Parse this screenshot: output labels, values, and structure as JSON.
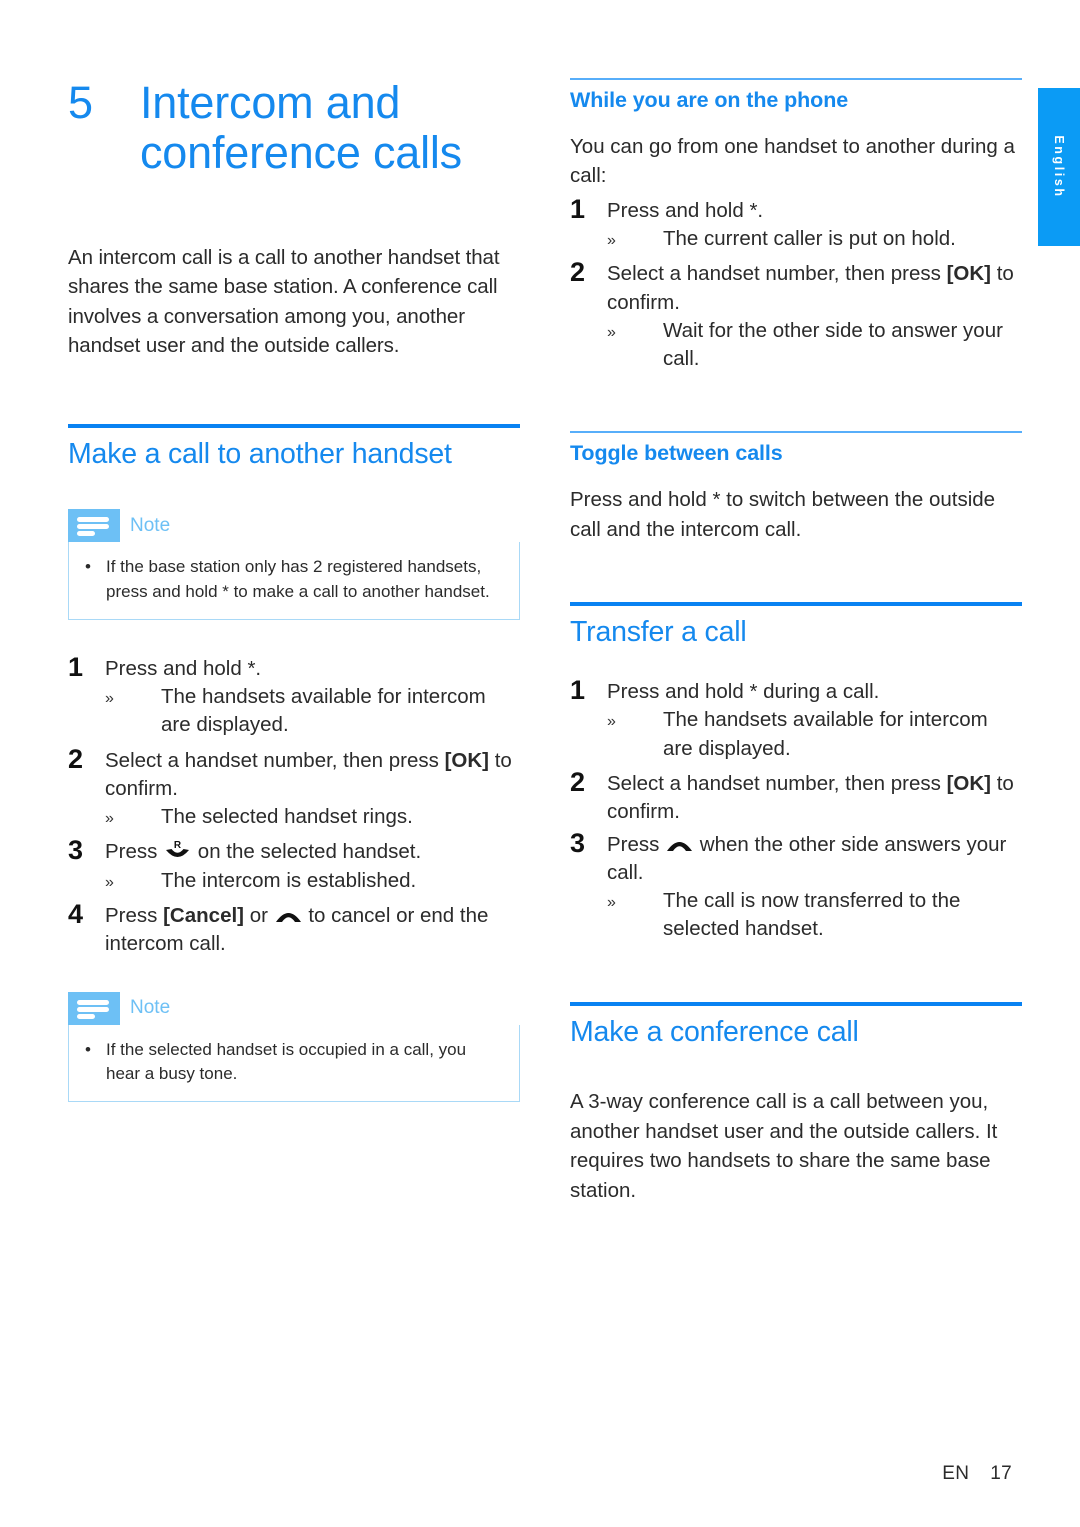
{
  "language_tab": {
    "label": "English"
  },
  "colors": {
    "heading_blue": "#1589EE",
    "rule_blue": "#0982F2",
    "subrule_blue": "#57AEFA",
    "note_blue": "#6DC0F5",
    "tab_blue": "#0B9BF5",
    "body_text": "#2B2B2B"
  },
  "chapter": {
    "number": "5",
    "title": "Intercom and conference calls",
    "intro": "An intercom call is a call to another handset that shares the same base station. A conference call involves a conversation among you, another handset user and the outside callers."
  },
  "left_column": {
    "section": {
      "title": "Make a call to another handset"
    },
    "note_1": {
      "label": "Note",
      "items": [
        "If the base station only has 2 registered handsets, press and hold * to make a call to another handset."
      ]
    },
    "steps": [
      {
        "num": "1",
        "text": "Press and hold *.",
        "results": [
          "The handsets available for intercom are displayed."
        ]
      },
      {
        "num": "2",
        "text_before": "Select a handset number, then press ",
        "key": "[OK]",
        "text_after": " to confirm.",
        "results": [
          "The selected handset rings."
        ]
      },
      {
        "num": "3",
        "text_before": "Press ",
        "icon": "recall-key-icon",
        "text_after": " on the selected handset.",
        "results": [
          "The intercom is established."
        ]
      },
      {
        "num": "4",
        "text_before": "Press ",
        "key": "[Cancel]",
        "text_middle": " or ",
        "icon": "hangup-icon",
        "text_after": " to cancel or end the intercom call.",
        "results": []
      }
    ],
    "note_2": {
      "label": "Note",
      "items": [
        "If the selected handset is occupied in a call, you hear a busy tone."
      ]
    }
  },
  "right_column": {
    "subsection_1": {
      "title": "While you are on the phone",
      "intro": "You can go from one handset to another during a call:",
      "steps": [
        {
          "num": "1",
          "text": "Press and hold *.",
          "results": [
            "The current caller is put on hold."
          ]
        },
        {
          "num": "2",
          "text_before": "Select a handset number, then press ",
          "key": "[OK]",
          "text_after": " to confirm.",
          "results": [
            "Wait for the other side to answer your call."
          ]
        }
      ]
    },
    "subsection_2": {
      "title": "Toggle between calls",
      "body": "Press and hold * to switch between the outside call and the intercom call."
    },
    "section_transfer": {
      "title": "Transfer a call",
      "steps": [
        {
          "num": "1",
          "text": "Press and hold * during a call.",
          "results": [
            "The handsets available for intercom are displayed."
          ]
        },
        {
          "num": "2",
          "text_before": "Select a handset number, then press ",
          "key": "[OK]",
          "text_after": " to confirm.",
          "results": []
        },
        {
          "num": "3",
          "text_before": "Press ",
          "icon": "hangup-icon",
          "text_after": " when the other side answers your call.",
          "results": [
            "The call is now transferred to the selected handset."
          ]
        }
      ]
    },
    "section_conference": {
      "title": "Make a conference call",
      "body": "A 3-way conference call is a call between you, another handset user and the outside callers. It requires two handsets to share the same base station."
    }
  },
  "markers": {
    "bullet": "•",
    "result_arrow": "»"
  },
  "footer": {
    "lang_code": "EN",
    "page_number": "17"
  }
}
